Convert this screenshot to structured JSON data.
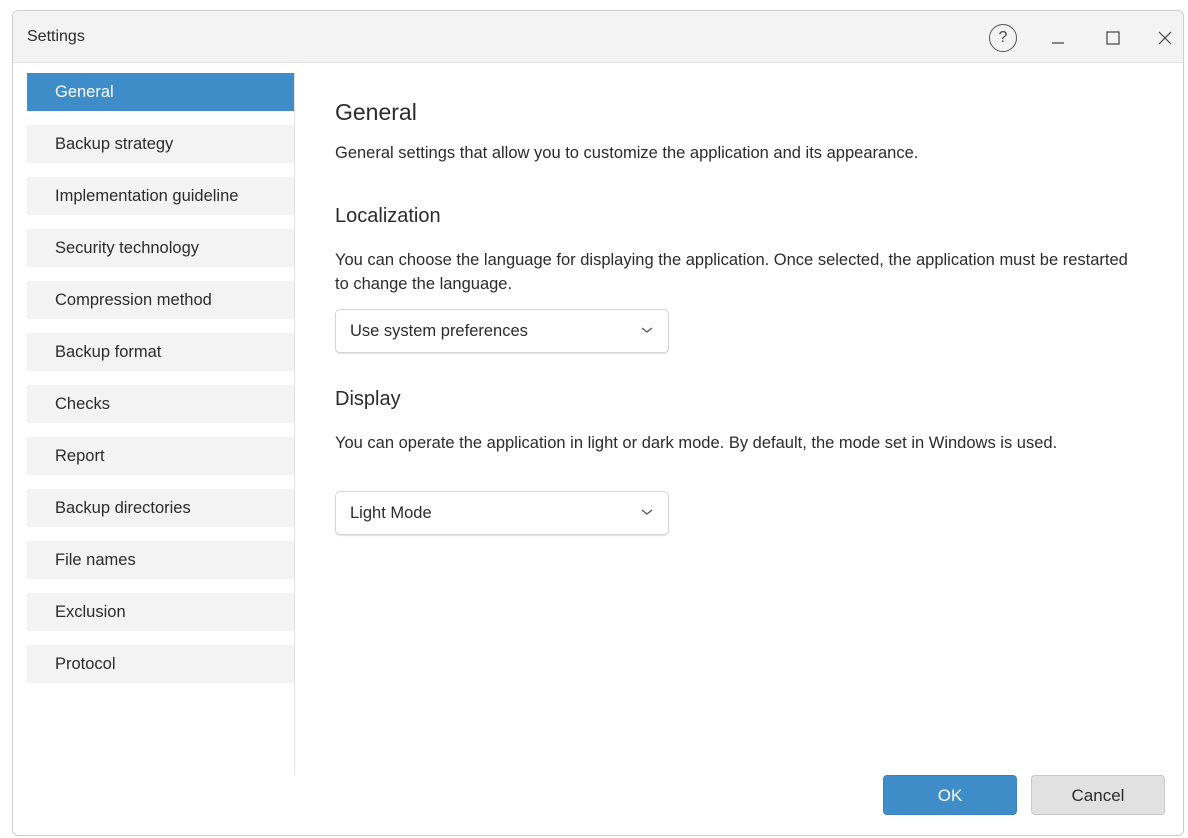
{
  "window": {
    "title": "Settings",
    "help_glyph": "?",
    "controls": [
      "help-icon",
      "minimize-icon",
      "maximize-icon",
      "close-icon"
    ]
  },
  "colors": {
    "accent": "#3f8dc8",
    "nav_bg": "#f3f3f3",
    "cancel_bg": "#e1e1e1"
  },
  "sidebar": {
    "active_index": 0,
    "items": [
      {
        "label": "General"
      },
      {
        "label": "Backup strategy"
      },
      {
        "label": "Implementation guideline"
      },
      {
        "label": "Security technology"
      },
      {
        "label": "Compression method"
      },
      {
        "label": "Backup format"
      },
      {
        "label": "Checks"
      },
      {
        "label": "Report"
      },
      {
        "label": "Backup directories"
      },
      {
        "label": "File names"
      },
      {
        "label": "Exclusion"
      },
      {
        "label": "Protocol"
      }
    ]
  },
  "main": {
    "title": "General",
    "description": "General settings that allow you to customize the application and its appearance.",
    "localization": {
      "heading": "Localization",
      "description": "You can choose the language for displaying the application. Once selected, the application must be restarted to change the language.",
      "select_value": "Use system preferences"
    },
    "display": {
      "heading": "Display",
      "description": "You can operate the application in light or dark mode. By default, the mode set in Windows is used.",
      "select_value": "Light Mode"
    }
  },
  "footer": {
    "ok_label": "OK",
    "cancel_label": "Cancel"
  }
}
